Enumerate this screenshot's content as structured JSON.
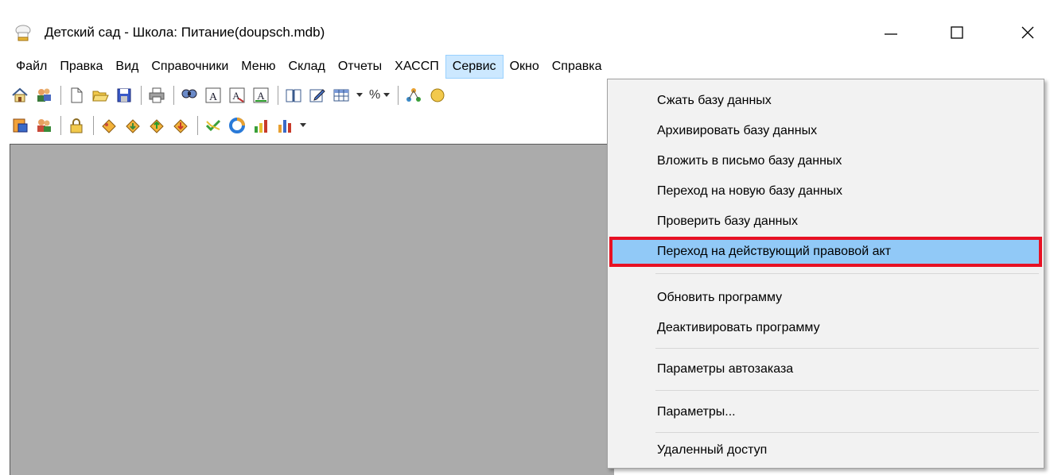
{
  "window": {
    "title": "Детский сад - Школа: Питание(doupsch.mdb)",
    "app_icon": "chef-hat-icon",
    "controls": [
      "minimize-icon",
      "maximize-icon",
      "close-icon"
    ]
  },
  "menubar": {
    "items": [
      {
        "label": "Файл"
      },
      {
        "label": "Правка"
      },
      {
        "label": "Вид"
      },
      {
        "label": "Справочники"
      },
      {
        "label": "Меню"
      },
      {
        "label": "Склад"
      },
      {
        "label": "Отчеты"
      },
      {
        "label": "ХАССП"
      },
      {
        "label": "Сервис"
      },
      {
        "label": "Окно"
      },
      {
        "label": "Справка"
      }
    ],
    "active_item": "Сервис"
  },
  "toolbar1": {
    "icons": [
      "home-icon",
      "users-icon",
      "new-document-icon",
      "open-folder-icon",
      "save-icon",
      "print-icon",
      "find-icon",
      "font-a-icon",
      "font-replace-icon",
      "font-format-icon",
      "book-icon",
      "edit-note-icon",
      "table-icon",
      "percent-icon",
      "diagram-icon",
      "globe-icon"
    ],
    "percent_text": "%"
  },
  "toolbar2": {
    "icons": [
      "report-icon",
      "group-icon",
      "lock-icon",
      "cake-icon",
      "arrow-box-icon",
      "package-up-icon",
      "package-down-icon",
      "check-chart-icon",
      "pie-icon",
      "bar-trend-icon",
      "bar-chart-icon"
    ]
  },
  "service_menu": {
    "items": [
      {
        "label": "Сжать базу данных"
      },
      {
        "label": "Архивировать базу данных"
      },
      {
        "label": "Вложить в письмо базу данных"
      },
      {
        "label": "Переход на новую базу данных"
      },
      {
        "label": "Проверить базу данных"
      },
      {
        "label": "Переход на действующий правовой акт",
        "highlighted": true
      },
      {
        "label": "Обновить программу"
      },
      {
        "label": "Деактивировать программу"
      },
      {
        "label": "Параметры автозаказа"
      },
      {
        "label": "Параметры..."
      },
      {
        "label": "Удаленный доступ"
      }
    ]
  },
  "colors": {
    "menu_active_bg": "#cce8ff",
    "highlight_bg": "#91c9f7",
    "highlight_border": "#e81123",
    "client_bg": "#ababab",
    "dropdown_bg": "#f2f2f2"
  }
}
